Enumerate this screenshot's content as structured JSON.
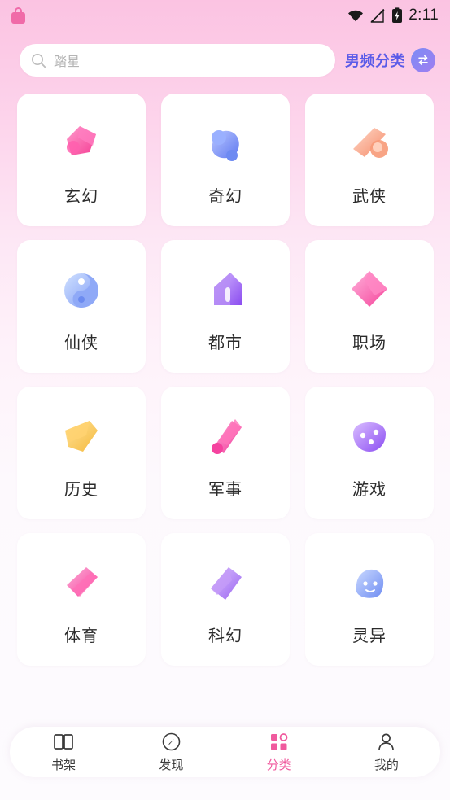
{
  "status_bar": {
    "lock_icon": "lock-icon",
    "wifi_icon": "wifi-icon",
    "signal_icon": "signal-off-icon",
    "battery_icon": "battery-charging-icon",
    "time": "2:11"
  },
  "search": {
    "icon": "search-icon",
    "placeholder": "踏星",
    "value": "踏星"
  },
  "category_switch": {
    "label": "男频分类",
    "icon": "swap-icon"
  },
  "colors": {
    "accent_pink": "#f05a9e",
    "accent_blue": "#5b5be8",
    "card_bg": "#ffffff"
  },
  "categories": [
    {
      "name": "玄幻",
      "icon": "玄幻-icon"
    },
    {
      "name": "奇幻",
      "icon": "奇幻-icon"
    },
    {
      "name": "武侠",
      "icon": "武侠-icon"
    },
    {
      "name": "仙侠",
      "icon": "仙侠-icon"
    },
    {
      "name": "都市",
      "icon": "都市-icon"
    },
    {
      "name": "职场",
      "icon": "职场-icon"
    },
    {
      "name": "历史",
      "icon": "历史-icon"
    },
    {
      "name": "军事",
      "icon": "军事-icon"
    },
    {
      "name": "游戏",
      "icon": "游戏-icon"
    },
    {
      "name": "体育",
      "icon": "体育-icon"
    },
    {
      "name": "科幻",
      "icon": "科幻-icon"
    },
    {
      "name": "灵异",
      "icon": "灵异-icon"
    }
  ],
  "bottom_nav": [
    {
      "label": "书架",
      "icon": "bookshelf-icon",
      "active": false
    },
    {
      "label": "发现",
      "icon": "compass-icon",
      "active": false
    },
    {
      "label": "分类",
      "icon": "grid-icon",
      "active": true
    },
    {
      "label": "我的",
      "icon": "person-icon",
      "active": false
    }
  ]
}
